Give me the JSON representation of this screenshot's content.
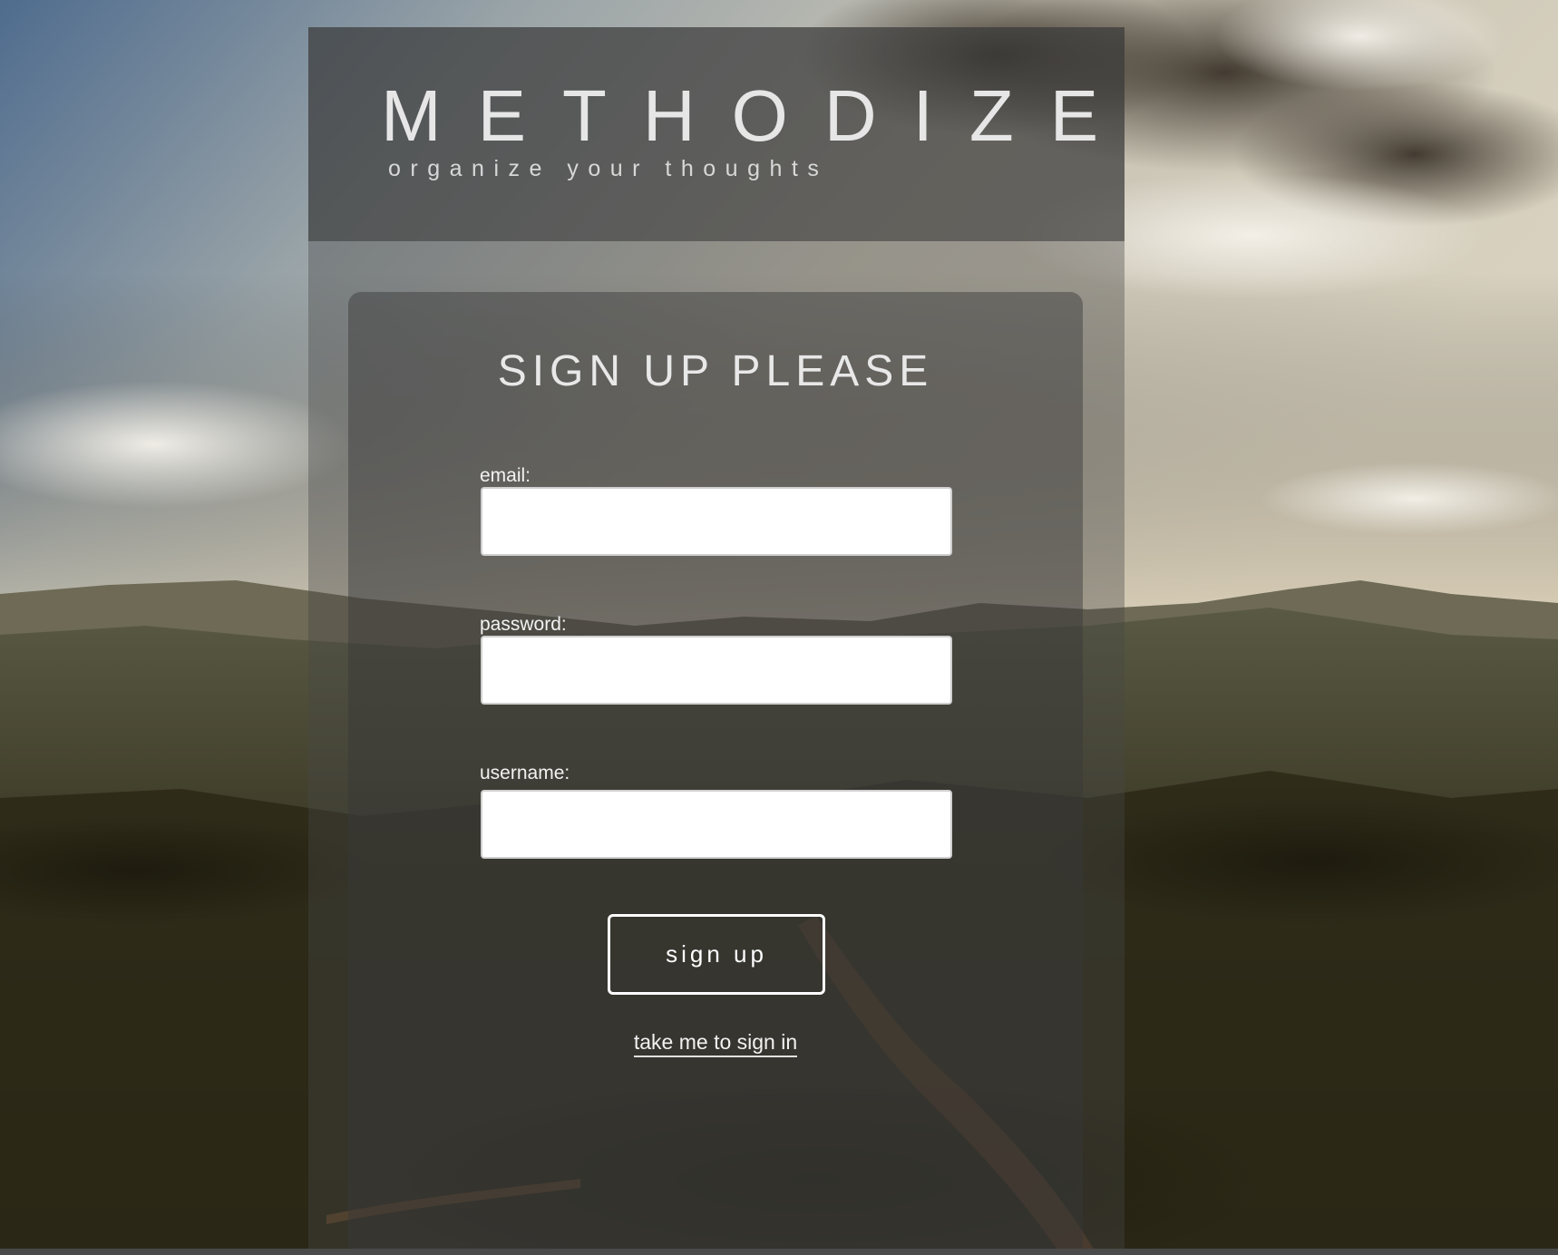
{
  "header": {
    "brand": "METHODIZE",
    "tagline": "organize your thoughts"
  },
  "signup_form": {
    "title": "SIGN UP PLEASE",
    "email": {
      "label": "email:",
      "value": ""
    },
    "password": {
      "label": "password:",
      "value": ""
    },
    "username": {
      "label": "username:",
      "value": ""
    },
    "submit_label": "sign up",
    "signin_link": "take me to sign in"
  },
  "colors": {
    "text": "#e6e6e6",
    "input_background": "#ffffff",
    "button_border": "#ffffff"
  }
}
